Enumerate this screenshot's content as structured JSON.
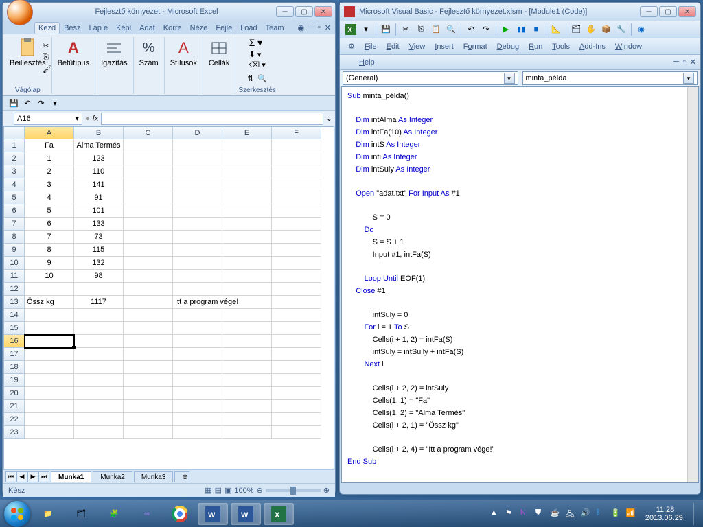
{
  "excel": {
    "title": "Fejlesztő környezet - Microsoft Excel",
    "tabs": [
      "Kezd",
      "Besz",
      "Lap e",
      "Képl",
      "Adat",
      "Korre",
      "Néze",
      "Fejle",
      "Load",
      "Team"
    ],
    "ribbon_groups": {
      "clipboard": {
        "paste": "Beillesztés",
        "label": "Vágólap"
      },
      "font": {
        "btn": "Betűtípus",
        "label": ""
      },
      "align": {
        "btn": "Igazítás"
      },
      "number": {
        "btn": "Szám"
      },
      "styles": {
        "btn": "Stílusok"
      },
      "cells": {
        "btn": "Cellák"
      },
      "edit": {
        "label": "Szerkesztés"
      }
    },
    "namebox": "A16",
    "columns": [
      "A",
      "B",
      "C",
      "D",
      "E",
      "F"
    ],
    "selected_cell": {
      "row": 16,
      "col": "A"
    },
    "data_rows": [
      {
        "n": 1,
        "A": "Fa",
        "B": "Alma Termés",
        "D": ""
      },
      {
        "n": 2,
        "A": "1",
        "B": "123",
        "D": ""
      },
      {
        "n": 3,
        "A": "2",
        "B": "110",
        "D": ""
      },
      {
        "n": 4,
        "A": "3",
        "B": "141",
        "D": ""
      },
      {
        "n": 5,
        "A": "4",
        "B": "91",
        "D": ""
      },
      {
        "n": 6,
        "A": "5",
        "B": "101",
        "D": ""
      },
      {
        "n": 7,
        "A": "6",
        "B": "133",
        "D": ""
      },
      {
        "n": 8,
        "A": "7",
        "B": "73",
        "D": ""
      },
      {
        "n": 9,
        "A": "8",
        "B": "115",
        "D": ""
      },
      {
        "n": 10,
        "A": "9",
        "B": "132",
        "D": ""
      },
      {
        "n": 11,
        "A": "10",
        "B": "98",
        "D": ""
      },
      {
        "n": 12,
        "A": "",
        "B": "",
        "D": ""
      },
      {
        "n": 13,
        "A": "Össz kg",
        "B": "1117",
        "D": "Itt a program vége!"
      },
      {
        "n": 14,
        "A": "",
        "B": "",
        "D": ""
      },
      {
        "n": 15,
        "A": "",
        "B": "",
        "D": ""
      },
      {
        "n": 16,
        "A": "",
        "B": "",
        "D": ""
      },
      {
        "n": 17,
        "A": "",
        "B": "",
        "D": ""
      },
      {
        "n": 18,
        "A": "",
        "B": "",
        "D": ""
      },
      {
        "n": 19,
        "A": "",
        "B": "",
        "D": ""
      },
      {
        "n": 20,
        "A": "",
        "B": "",
        "D": ""
      },
      {
        "n": 21,
        "A": "",
        "B": "",
        "D": ""
      },
      {
        "n": 22,
        "A": "",
        "B": "",
        "D": ""
      },
      {
        "n": 23,
        "A": "",
        "B": "",
        "D": ""
      }
    ],
    "sheets": [
      "Munka1",
      "Munka2",
      "Munka3"
    ],
    "status": "Kész",
    "zoom": "100%"
  },
  "vb": {
    "title": "Microsoft Visual Basic - Fejlesztő környezet.xlsm - [Module1 (Code)]",
    "menus": [
      "File",
      "Edit",
      "View",
      "Insert",
      "Format",
      "Debug",
      "Run",
      "Tools",
      "Add-Ins",
      "Window"
    ],
    "help": "Help",
    "combo_left": "(General)",
    "combo_right": "minta_példa",
    "code": [
      {
        "t": "Sub",
        "c": "kw"
      },
      {
        "t": " minta_példa()",
        "c": ""
      },
      {
        "nl": 1
      },
      {
        "nl": 1
      },
      {
        "t": "    ",
        "c": ""
      },
      {
        "t": "Dim",
        "c": "kw"
      },
      {
        "t": " intAlma ",
        "c": ""
      },
      {
        "t": "As Integer",
        "c": "kw"
      },
      {
        "nl": 1
      },
      {
        "t": "    ",
        "c": ""
      },
      {
        "t": "Dim",
        "c": "kw"
      },
      {
        "t": " intFa(10) ",
        "c": ""
      },
      {
        "t": "As Integer",
        "c": "kw"
      },
      {
        "nl": 1
      },
      {
        "t": "    ",
        "c": ""
      },
      {
        "t": "Dim",
        "c": "kw"
      },
      {
        "t": " intS ",
        "c": ""
      },
      {
        "t": "As Integer",
        "c": "kw"
      },
      {
        "nl": 1
      },
      {
        "t": "    ",
        "c": ""
      },
      {
        "t": "Dim",
        "c": "kw"
      },
      {
        "t": " inti ",
        "c": ""
      },
      {
        "t": "As Integer",
        "c": "kw"
      },
      {
        "nl": 1
      },
      {
        "t": "    ",
        "c": ""
      },
      {
        "t": "Dim",
        "c": "kw"
      },
      {
        "t": " intSuly ",
        "c": ""
      },
      {
        "t": "As Integer",
        "c": "kw"
      },
      {
        "nl": 1
      },
      {
        "nl": 1
      },
      {
        "t": "    ",
        "c": ""
      },
      {
        "t": "Open",
        "c": "kw"
      },
      {
        "t": " \"adat.txt\" ",
        "c": ""
      },
      {
        "t": "For Input As",
        "c": "kw"
      },
      {
        "t": " #1",
        "c": ""
      },
      {
        "nl": 1
      },
      {
        "nl": 1
      },
      {
        "t": "            S = 0",
        "c": ""
      },
      {
        "nl": 1
      },
      {
        "t": "        ",
        "c": ""
      },
      {
        "t": "Do",
        "c": "kw"
      },
      {
        "nl": 1
      },
      {
        "t": "            S = S + 1",
        "c": ""
      },
      {
        "nl": 1
      },
      {
        "t": "            Input #1, intFa(S)",
        "c": ""
      },
      {
        "nl": 1
      },
      {
        "nl": 1
      },
      {
        "t": "        ",
        "c": ""
      },
      {
        "t": "Loop Until",
        "c": "kw"
      },
      {
        "t": " EOF(1)",
        "c": ""
      },
      {
        "nl": 1
      },
      {
        "t": "    ",
        "c": ""
      },
      {
        "t": "Close",
        "c": "kw"
      },
      {
        "t": " #1",
        "c": ""
      },
      {
        "nl": 1
      },
      {
        "nl": 1
      },
      {
        "t": "            intSuly = 0",
        "c": ""
      },
      {
        "nl": 1
      },
      {
        "t": "        ",
        "c": ""
      },
      {
        "t": "For",
        "c": "kw"
      },
      {
        "t": " i = 1 ",
        "c": ""
      },
      {
        "t": "To",
        "c": "kw"
      },
      {
        "t": " S",
        "c": ""
      },
      {
        "nl": 1
      },
      {
        "t": "            Cells(i + 1, 2) = intFa(S)",
        "c": ""
      },
      {
        "nl": 1
      },
      {
        "t": "            intSuly = intSully + intFa(S)",
        "c": ""
      },
      {
        "nl": 1
      },
      {
        "t": "        ",
        "c": ""
      },
      {
        "t": "Next",
        "c": "kw"
      },
      {
        "t": " i",
        "c": ""
      },
      {
        "nl": 1
      },
      {
        "nl": 1
      },
      {
        "t": "            Cells(i + 2, 2) = intSuly",
        "c": ""
      },
      {
        "nl": 1
      },
      {
        "t": "            Cells(1, 1) = \"Fa\"",
        "c": ""
      },
      {
        "nl": 1
      },
      {
        "t": "            Cells(1, 2) = \"Alma Termés\"",
        "c": ""
      },
      {
        "nl": 1
      },
      {
        "t": "            Cells(i + 2, 1) = \"Össz kg\"",
        "c": ""
      },
      {
        "nl": 1
      },
      {
        "nl": 1
      },
      {
        "t": "            Cells(i + 2, 4) = \"Itt a program vége!\"",
        "c": ""
      },
      {
        "nl": 1
      },
      {
        "t": "End Sub",
        "c": "kw"
      },
      {
        "nl": 1
      }
    ]
  },
  "taskbar": {
    "time": "11:28",
    "date": "2013.06.29."
  }
}
